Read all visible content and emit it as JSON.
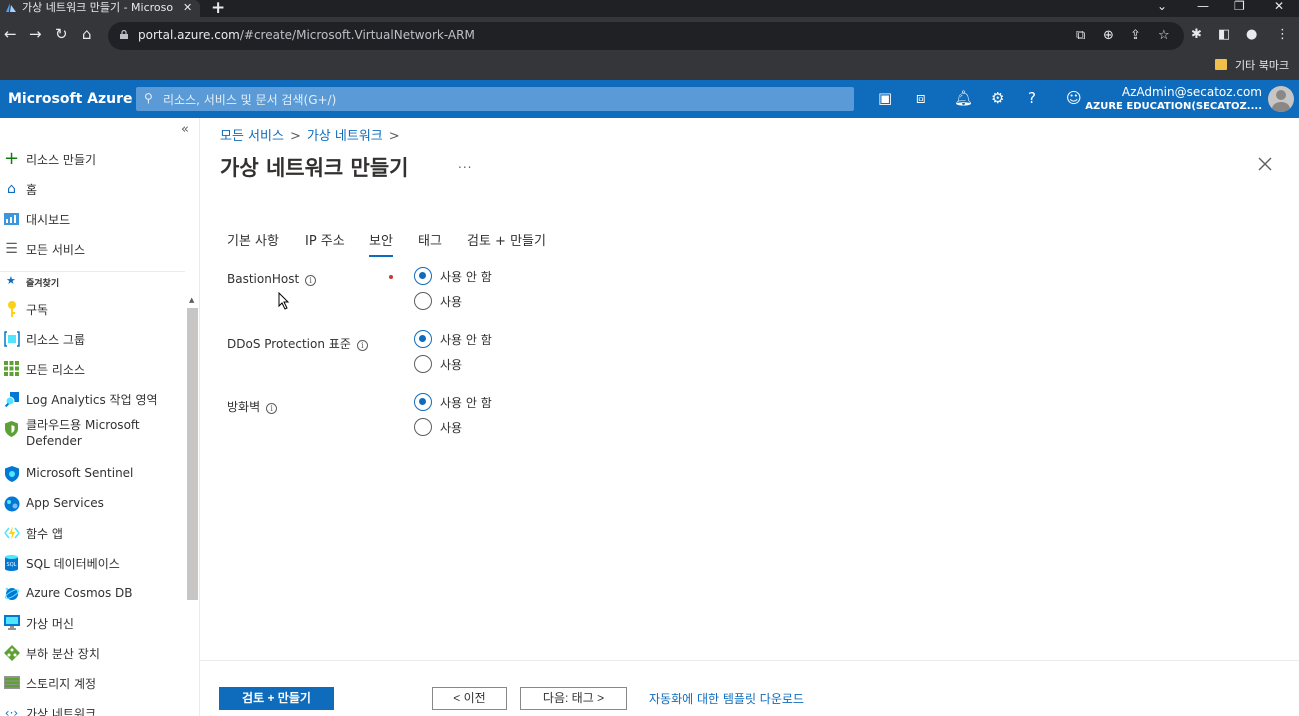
{
  "browser": {
    "tab_title": "가상 네트워크 만들기 - Microso",
    "tab_close": "✕",
    "new_tab": "+",
    "url_host": "portal.azure.com",
    "url_path": "/#create/Microsoft.VirtualNetwork-ARM",
    "bookmark_folder": "기타 북마크",
    "icons": [
      "back-icon",
      "forward-icon",
      "reload-icon",
      "home-icon",
      "lock-icon",
      "open-in-app-icon",
      "zoom-icon",
      "share-icon",
      "star-icon",
      "extensions-icon",
      "sidepanel-icon",
      "profile-icon",
      "menu-icon"
    ]
  },
  "header": {
    "brand": "Microsoft Azure",
    "search_placeholder": "리소스, 서비스 및 문서 검색(G+/)",
    "account_name": "AzAdmin@secatoz.com",
    "account_tenant": "AZURE EDUCATION(SECATOZ....",
    "brand_color": "#0f6cbd",
    "icons": [
      "cloud-shell-icon",
      "directory-filter-icon",
      "bell-icon",
      "gear-icon",
      "help-icon",
      "feedback-icon"
    ]
  },
  "sidebar": {
    "collapse": "«",
    "items": [
      {
        "label": "리소스 만들기",
        "icon": "plus-icon"
      },
      {
        "label": "홈",
        "icon": "home-icon"
      },
      {
        "label": "대시보드",
        "icon": "dashboard-icon"
      },
      {
        "label": "모든 서비스",
        "icon": "list-icon"
      }
    ],
    "favorites_label": "즐겨찾기",
    "favorites": [
      {
        "label": "구독",
        "icon": "key-icon"
      },
      {
        "label": "리소스 그룹",
        "icon": "resource-group-icon"
      },
      {
        "label": "모든 리소스",
        "icon": "grid-icon"
      },
      {
        "label": "Log Analytics 작업 영역",
        "icon": "log-analytics-icon"
      },
      {
        "label": "클라우드용 Microsoft Defender",
        "icon": "shield-icon"
      },
      {
        "label": "Microsoft Sentinel",
        "icon": "sentinel-icon"
      },
      {
        "label": "App Services",
        "icon": "globe-icon"
      },
      {
        "label": "함수 앱",
        "icon": "lightning-icon"
      },
      {
        "label": "SQL 데이터베이스",
        "icon": "sql-icon"
      },
      {
        "label": "Azure Cosmos DB",
        "icon": "cosmos-icon"
      },
      {
        "label": "가상 머신",
        "icon": "monitor-icon"
      },
      {
        "label": "부하 분산 장치",
        "icon": "diamond-icon"
      },
      {
        "label": "스토리지 계정",
        "icon": "storage-icon"
      },
      {
        "label": "가상 네트워크",
        "icon": "network-icon"
      }
    ]
  },
  "main": {
    "breadcrumb": [
      "모든 서비스",
      "가상 네트워크"
    ],
    "breadcrumb_sep": ">",
    "title": "가상 네트워크 만들기",
    "more": "...",
    "tabs": [
      {
        "label": "기본 사항",
        "active": false
      },
      {
        "label": "IP 주소",
        "active": false
      },
      {
        "label": "보안",
        "active": true
      },
      {
        "label": "태그",
        "active": false
      },
      {
        "label": "검토 + 만들기",
        "active": false
      }
    ],
    "fields": [
      {
        "label": "BastionHost",
        "required": true,
        "options": [
          "사용 안 함",
          "사용"
        ],
        "selected": 0
      },
      {
        "label": "DDoS Protection 표준",
        "required": false,
        "options": [
          "사용 안 함",
          "사용"
        ],
        "selected": 0
      },
      {
        "label": "방화벽",
        "required": false,
        "options": [
          "사용 안 함",
          "사용"
        ],
        "selected": 0
      }
    ]
  },
  "footer": {
    "review_create": "검토 + 만들기",
    "previous": "< 이전",
    "next": "다음: 태그 >",
    "template_link": "자동화에 대한 템플릿 다운로드"
  }
}
